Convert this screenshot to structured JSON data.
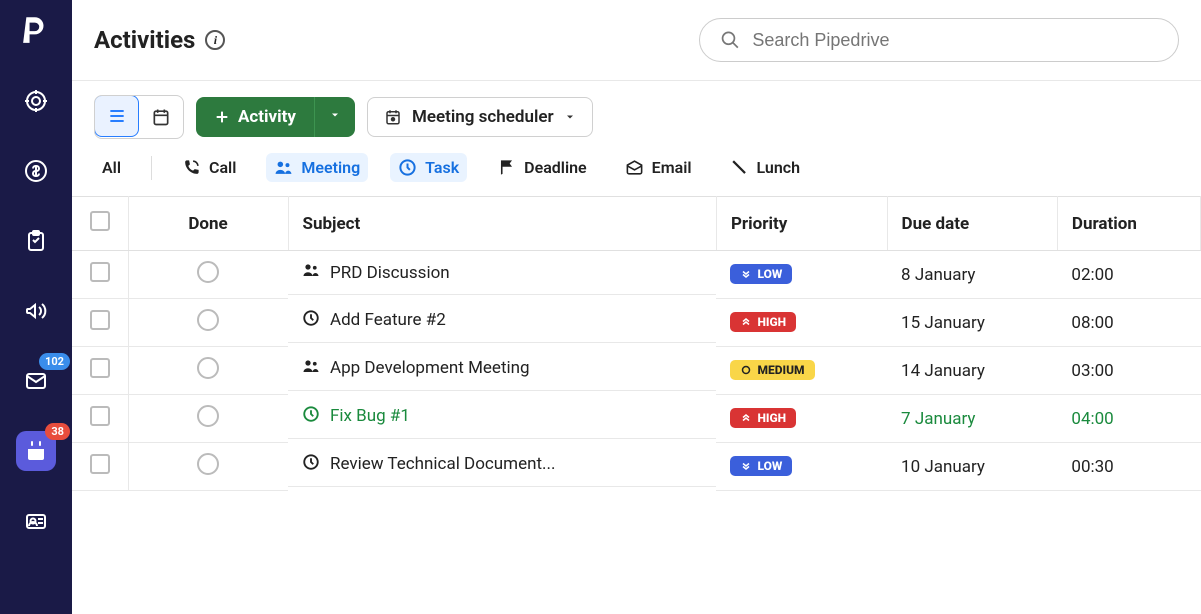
{
  "sidebar": {
    "items": [
      {
        "name": "target"
      },
      {
        "name": "dollar"
      },
      {
        "name": "clipboard"
      },
      {
        "name": "megaphone"
      },
      {
        "name": "mail",
        "badge": "102",
        "badge_color": "blue"
      },
      {
        "name": "calendar",
        "badge": "38",
        "badge_color": "red",
        "active": true
      },
      {
        "name": "contacts"
      }
    ]
  },
  "header": {
    "title": "Activities"
  },
  "search": {
    "placeholder": "Search Pipedrive"
  },
  "toolbar": {
    "activity_label": "Activity",
    "scheduler_label": "Meeting scheduler"
  },
  "filters": {
    "all": "All",
    "call": "Call",
    "meeting": "Meeting",
    "task": "Task",
    "deadline": "Deadline",
    "email": "Email",
    "lunch": "Lunch"
  },
  "table": {
    "headers": {
      "done": "Done",
      "subject": "Subject",
      "priority": "Priority",
      "due_date": "Due date",
      "duration": "Duration"
    },
    "rows": [
      {
        "icon": "people",
        "subject": "PRD Discussion",
        "priority": "LOW",
        "priority_class": "low",
        "priority_icon": "chevdown",
        "due": "8 January",
        "duration": "02:00",
        "highlight": false
      },
      {
        "icon": "clock",
        "subject": "Add Feature #2",
        "priority": "HIGH",
        "priority_class": "high",
        "priority_icon": "chevup",
        "due": "15 January",
        "duration": "08:00",
        "highlight": false
      },
      {
        "icon": "people",
        "subject": "App Development Meeting",
        "priority": "MEDIUM",
        "priority_class": "medium",
        "priority_icon": "circle",
        "due": "14 January",
        "duration": "03:00",
        "highlight": false
      },
      {
        "icon": "clock",
        "subject": "Fix Bug #1",
        "priority": "HIGH",
        "priority_class": "high",
        "priority_icon": "chevup",
        "due": "7 January",
        "duration": "04:00",
        "highlight": true
      },
      {
        "icon": "clock",
        "subject": "Review Technical Document...",
        "priority": "LOW",
        "priority_class": "low",
        "priority_icon": "chevdown",
        "due": "10 January",
        "duration": "00:30",
        "highlight": false
      }
    ]
  }
}
